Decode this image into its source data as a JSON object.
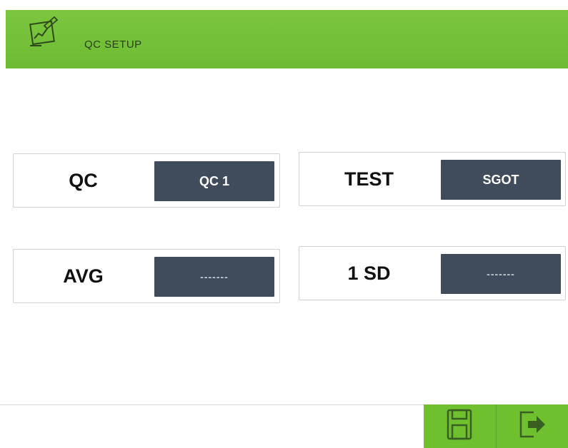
{
  "header": {
    "title": "QC SETUP",
    "icon": "chart-edit-icon",
    "color": "#74c13a"
  },
  "fields": {
    "qc": {
      "label": "QC",
      "value": "QC 1"
    },
    "test": {
      "label": "TEST",
      "value": "SGOT"
    },
    "avg": {
      "label": "AVG",
      "value": "-------"
    },
    "sd": {
      "label": "1 SD",
      "value": "-------"
    }
  },
  "footer": {
    "save_icon": "save-icon",
    "exit_icon": "exit-icon",
    "color": "#6ec02f"
  },
  "colors": {
    "value_box": "#404c5c",
    "accent": "#74c13a"
  }
}
